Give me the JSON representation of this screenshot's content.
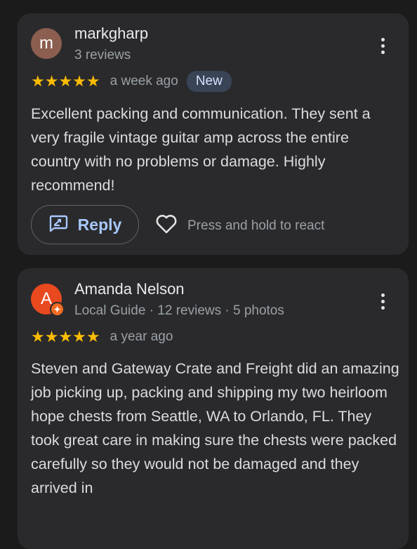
{
  "reviews": [
    {
      "avatar_letter": "m",
      "avatar_color": "#8b5e4f",
      "name": "markgharp",
      "meta": "3 reviews",
      "rating": 5,
      "stars": "★★★★★",
      "date": "a week ago",
      "badge": "New",
      "text": "Excellent packing and communication. They sent a very fragile vintage guitar amp across the entire country with no problems or damage. Highly recommend!",
      "reply_label": "Reply",
      "react_label": "Press and hold to react"
    },
    {
      "avatar_letter": "A",
      "avatar_color": "#e8491f",
      "name": "Amanda Nelson",
      "meta": "Local Guide · 12 reviews · 5 photos",
      "rating": 5,
      "stars": "★★★★★",
      "date": "a year ago",
      "text": "Steven and Gateway Crate and Freight did an amazing job picking up, packing and shipping my two heirloom hope chests from Seattle, WA to Orlando, FL. They took great care in making sure the chests were packed carefully so they would not be damaged and they arrived in"
    }
  ],
  "colors": {
    "background": "#1b1b1c",
    "card": "#2a2a2c",
    "star": "#fbbc04",
    "accent": "#a8c7fa",
    "badge_bg": "#394457"
  },
  "icons": {
    "more": "more-vert-icon",
    "reply": "reply-icon",
    "react": "heart-outline-icon",
    "local_guide": "local-guide-badge-icon"
  }
}
